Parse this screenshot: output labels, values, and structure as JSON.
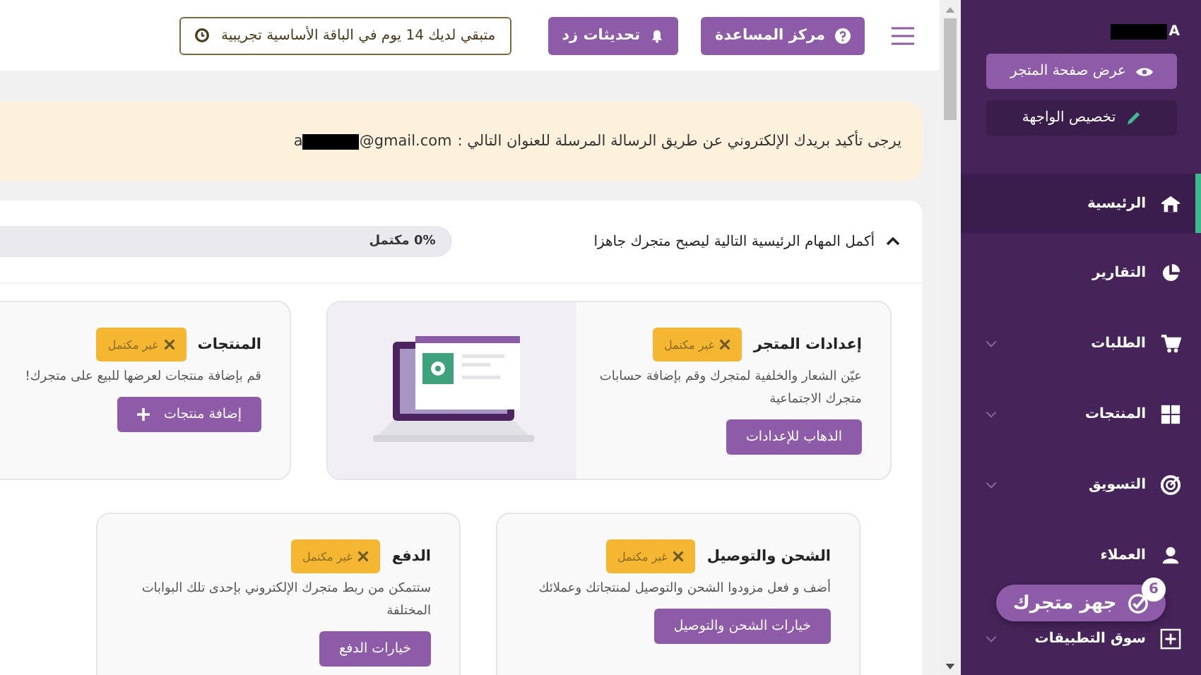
{
  "sidebar": {
    "user_name": "A",
    "buttons": [
      {
        "label": "عرض صفحة المتجر",
        "kind": "view"
      },
      {
        "label": "تخصيص الواجهة",
        "kind": "customize"
      }
    ],
    "items": [
      {
        "label": "الرئيسية",
        "selected": true,
        "expandable": false
      },
      {
        "label": "التقارير",
        "selected": false,
        "expandable": false
      },
      {
        "label": "الطلبات",
        "selected": false,
        "expandable": true
      },
      {
        "label": "المنتجات",
        "selected": false,
        "expandable": true
      },
      {
        "label": "التسويق",
        "selected": false,
        "expandable": true
      },
      {
        "label": "العملاء",
        "selected": false,
        "expandable": false
      },
      {
        "label": "سوق التطبيقات",
        "selected": false,
        "expandable": true
      }
    ]
  },
  "topbar": {
    "help": "مركز المساعدة",
    "updates": "تحديثات زد",
    "trial": "متبقي لديك 14 يوم في الباقة الأساسية تجريبية"
  },
  "banner": {
    "message": "يرجى تأكيد بريدك الإلكتروني عن طريق الرسالة المرسلة للعنوان التالي :",
    "email_start": "a",
    "email_end": "@gmail.com"
  },
  "tasks": {
    "title": "أكمل المهام الرئيسية التالية ليصبح متجرك جاهزا",
    "expanded": true,
    "progress": "0% مكتمل",
    "level": 0,
    "cards": [
      {
        "title": "إعدادات المتجر",
        "status": "غير مكتمل",
        "completed": false,
        "description": "عيّن الشعار والخلفية لمتجرك وقم بإضافة حسابات متجرك الاجتماعية",
        "button": "الذهاب للإعدادات",
        "kind": "illustrated"
      },
      {
        "title": "المنتجات",
        "status": "غير مكتمل",
        "completed": false,
        "description": "قم بإضافة منتجات لعرضها للبيع على متجرك!",
        "button": "إضافة منتجات",
        "kind": "add"
      },
      {
        "title": "الشحن والتوصيل",
        "status": "غير مكتمل",
        "completed": false,
        "description": "أضف و فعل مزودوا الشحن والتوصيل لمنتجاتك وعملائك",
        "button": "خيارات الشحن والتوصيل",
        "kind": "plain"
      },
      {
        "title": "الدفع",
        "status": "غير مكتمل",
        "completed": false,
        "description": "ستتمكن من ربط متجرك الإلكتروني بإحدى تلك البوابات المختلفة",
        "button": "خيارات الدفع",
        "kind": "plain"
      }
    ]
  },
  "setup_button": {
    "label": "جهز متجرك",
    "count": "6"
  }
}
